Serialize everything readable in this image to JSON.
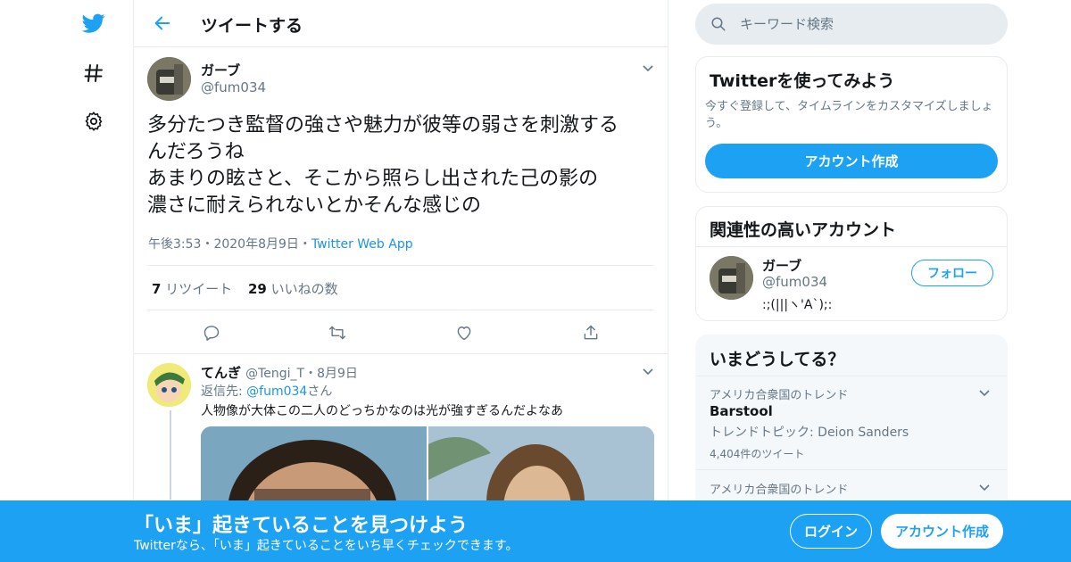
{
  "nav": {
    "logo": "twitter-bird-icon",
    "items": [
      {
        "icon": "hashtag-icon",
        "label": "#"
      },
      {
        "icon": "gear-icon"
      }
    ]
  },
  "header": {
    "back_icon": "arrow-left-icon",
    "title": "ツイートする"
  },
  "tweet": {
    "name": "ガーブ",
    "handle": "@fum034",
    "text_lines": [
      "多分たつき監督の強さや魅力が彼等の弱さを刺激する",
      "んだろうね",
      "あまりの眩さと、そこから照らし出された己の影の",
      "濃さに耐えられないとかそんな感じの"
    ],
    "time": "午後3:53",
    "date": "2020年8月9日",
    "dot": "・",
    "source": "Twitter Web App",
    "retweets": "7",
    "retweets_label": "リツイート",
    "likes": "29",
    "likes_label": "いいねの数"
  },
  "reply": {
    "name": "てんぎ",
    "handle": "@Tengi_T",
    "date": "・8月9日",
    "reply_to_prefix": "返信先: ",
    "reply_to_handle": "@fum034",
    "reply_to_suffix": "さん",
    "text": "人物像が大体この二人のどっちかなのは光が強すぎるんだよなあ"
  },
  "search": {
    "placeholder": "キーワード検索"
  },
  "signup_card": {
    "title": "Twitterを使ってみよう",
    "description_line1": "今すぐ登録して、タイムラインをカスタマイズしましょ",
    "description_line2": "う。",
    "button": "アカウント作成"
  },
  "related_card": {
    "title": "関連性の高いアカウント",
    "name": "ガーブ",
    "handle": "@fum034",
    "bio": ":;(|||ヽ'A`);:",
    "follow_button": "フォロー"
  },
  "trends_card": {
    "title": "いまどうしてる？",
    "items": [
      {
        "context": "アメリカ合衆国のトレンド",
        "name": "Barstool",
        "topic": "トレンドトピック: Deion Sanders",
        "count": "4,404件のツイート"
      },
      {
        "context": "アメリカ合衆国のトレンド"
      }
    ]
  },
  "banner": {
    "title": "「いま」起きていることを見つけよう",
    "subtitle": "Twitterなら、「いま」起きていることをいち早くチェックできます。",
    "login": "ログイン",
    "signup": "アカウント作成"
  },
  "colors": {
    "brand": "#1da1f2",
    "link": "#1b95e0",
    "secondary_text": "#657786",
    "border": "#e6ecf0",
    "card_bg": "#f5f8fa"
  }
}
